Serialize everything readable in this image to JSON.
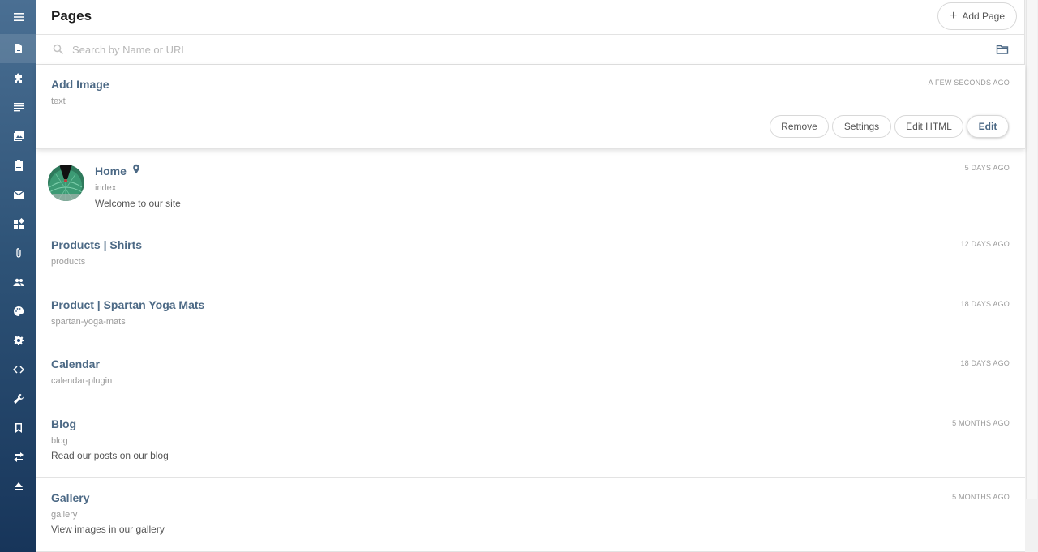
{
  "header": {
    "title": "Pages",
    "add_button_label": "Add Page",
    "add_icon": "plus-icon"
  },
  "search": {
    "placeholder": "Search by Name or URL",
    "value": ""
  },
  "sidebar": {
    "items": [
      {
        "icon": "menu-icon"
      },
      {
        "icon": "pages-icon",
        "active": true
      },
      {
        "icon": "plugins-icon"
      },
      {
        "icon": "content-icon"
      },
      {
        "icon": "images-icon"
      },
      {
        "icon": "clipboard-icon"
      },
      {
        "icon": "mail-icon"
      },
      {
        "icon": "dashboard-icon"
      },
      {
        "icon": "attachment-icon"
      },
      {
        "icon": "users-icon"
      },
      {
        "icon": "palette-icon"
      },
      {
        "icon": "settings-icon"
      },
      {
        "icon": "code-icon"
      },
      {
        "icon": "wrench-icon"
      },
      {
        "icon": "bookmark-icon"
      },
      {
        "icon": "swap-icon"
      },
      {
        "icon": "eject-icon"
      }
    ]
  },
  "selected_actions": {
    "remove": "Remove",
    "settings": "Settings",
    "edit_html": "Edit HTML",
    "edit": "Edit"
  },
  "pages": [
    {
      "title": "Add Image",
      "url": "text",
      "description": "",
      "time": "A FEW SECONDS AGO"
    },
    {
      "title": "Home",
      "url": "index",
      "description": "Welcome to our site",
      "time": "5 DAYS AGO"
    },
    {
      "title": "Products | Shirts",
      "url": "products",
      "description": "",
      "time": "12 DAYS AGO"
    },
    {
      "title": "Product | Spartan Yoga Mats",
      "url": "spartan-yoga-mats",
      "description": "",
      "time": "18 DAYS AGO"
    },
    {
      "title": "Calendar",
      "url": "calendar-plugin",
      "description": "",
      "time": "18 DAYS AGO"
    },
    {
      "title": "Blog",
      "url": "blog",
      "description": "Read our posts on our blog",
      "time": "5 MONTHS AGO"
    },
    {
      "title": "Gallery",
      "url": "gallery",
      "description": "View images in our gallery",
      "time": "5 MONTHS AGO"
    }
  ]
}
